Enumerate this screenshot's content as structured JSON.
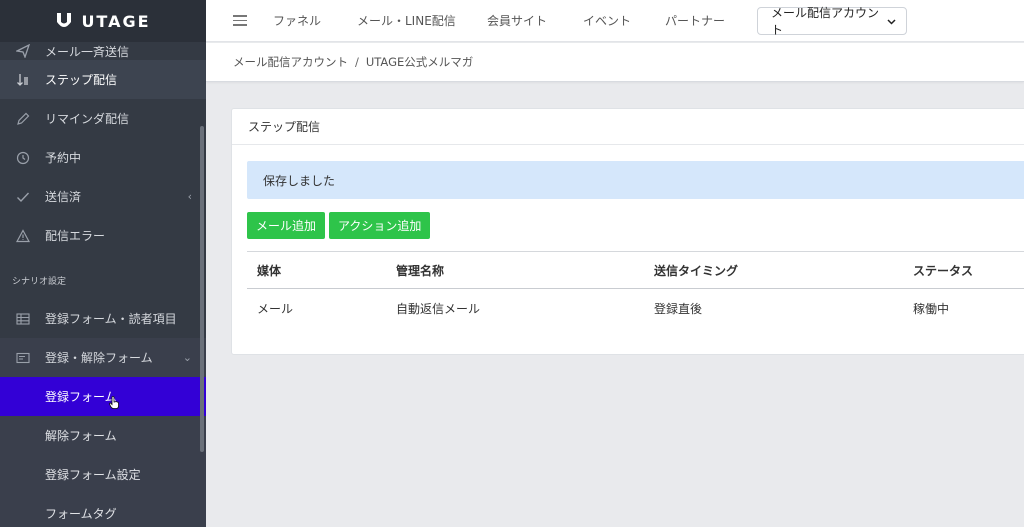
{
  "brand": {
    "name": "UTAGE"
  },
  "sidebar": {
    "items": [
      {
        "label": "メール一斉送信",
        "icon": "send-icon"
      },
      {
        "label": "ステップ配信",
        "icon": "step-sort-icon"
      },
      {
        "label": "リマインダ配信",
        "icon": "pencil-icon"
      },
      {
        "label": "予約中",
        "icon": "history-icon"
      },
      {
        "label": "送信済",
        "icon": "check-icon"
      },
      {
        "label": "配信エラー",
        "icon": "warning-icon"
      }
    ],
    "section_title": "シナリオ設定",
    "scenario_items": [
      {
        "label": "登録フォーム・読者項目",
        "icon": "table-icon"
      },
      {
        "label": "登録・解除フォーム",
        "icon": "form-icon"
      }
    ],
    "sub_items": [
      "登録フォーム",
      "解除フォーム",
      "登録フォーム設定",
      "フォームタグ"
    ],
    "selected_color": "#3300d6"
  },
  "topbar": {
    "nav": [
      "ファネル",
      "メール・LINE配信",
      "会員サイト",
      "イベント",
      "パートナー"
    ],
    "account_select": "メール配信アカウント"
  },
  "breadcrumb": [
    "メール配信アカウント",
    "UTAGE公式メルマガ"
  ],
  "card": {
    "title": "ステップ配信",
    "alert": "保存しました",
    "buttons": {
      "add_mail": "メール追加",
      "add_action": "アクション追加"
    },
    "table": {
      "headers": [
        "媒体",
        "管理名称",
        "送信タイミング",
        "ステータス"
      ],
      "rows": [
        [
          "メール",
          "自動返信メール",
          "登録直後",
          "稼働中"
        ]
      ]
    }
  },
  "colors": {
    "button_green": "#2ec44a",
    "alert_bg": "#d5e7fb",
    "sidebar_bg": "#343a44"
  }
}
